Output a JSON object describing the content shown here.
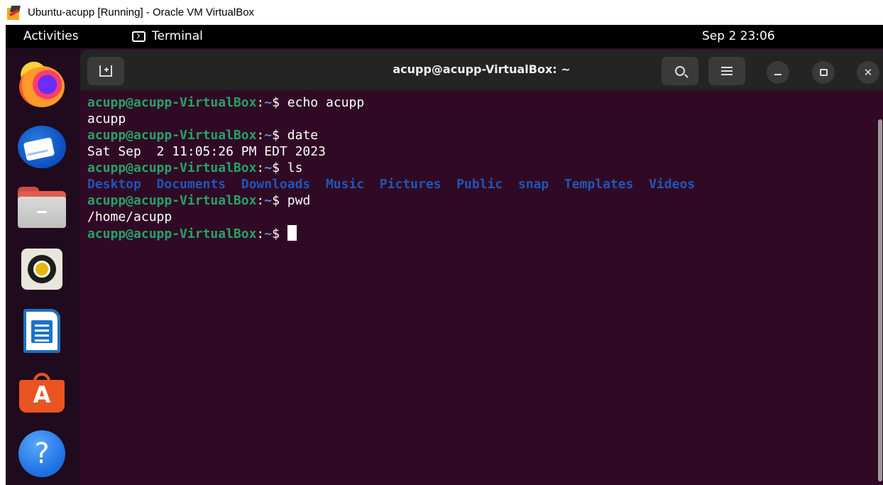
{
  "host": {
    "title": "Ubuntu-acupp [Running] - Oracle VM VirtualBox"
  },
  "topbar": {
    "activities": "Activities",
    "app_name": "Terminal",
    "clock": "Sep 2  23:06"
  },
  "dock": {
    "items": [
      "firefox-icon",
      "thunderbird-icon",
      "files-icon",
      "rhythmbox-icon",
      "libreoffice-writer-icon",
      "app-center-icon",
      "help-icon"
    ],
    "app_center_letter": "A",
    "help_glyph": "?"
  },
  "terminal": {
    "title": "acupp@acupp-VirtualBox: ~",
    "prompt_user": "acupp@acupp-VirtualBox",
    "prompt_sep": ":",
    "prompt_path": "~",
    "prompt_symbol": "$ ",
    "lines": [
      {
        "type": "cmd",
        "command": "echo acupp"
      },
      {
        "type": "out",
        "text": "acupp"
      },
      {
        "type": "cmd",
        "command": "date"
      },
      {
        "type": "out",
        "text": "Sat Sep  2 11:05:26 PM EDT 2023"
      },
      {
        "type": "cmd",
        "command": "ls"
      },
      {
        "type": "ls",
        "text": "Desktop  Documents  Downloads  Music  Pictures  Public  snap  Templates  Videos"
      },
      {
        "type": "cmd",
        "command": "pwd"
      },
      {
        "type": "out",
        "text": "/home/acupp"
      },
      {
        "type": "prompt",
        "command": ""
      }
    ]
  },
  "colors": {
    "terminal_bg": "#300a24",
    "prompt_user": "#26a269",
    "prompt_path": "#5b8ed1",
    "ls_dir": "#1e56ba",
    "header_bg": "#242424"
  }
}
